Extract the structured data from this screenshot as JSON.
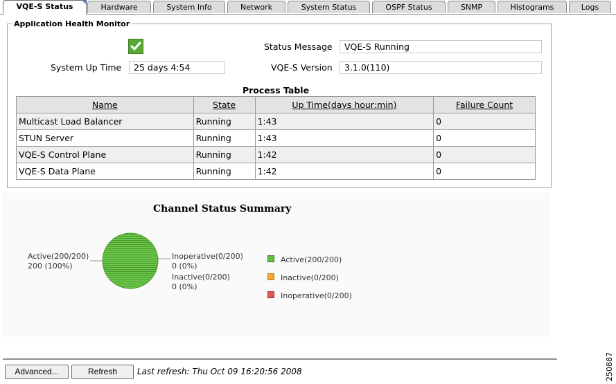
{
  "tabs": [
    {
      "label": "VQE-S Status",
      "active": true
    },
    {
      "label": "Hardware"
    },
    {
      "label": "System Info"
    },
    {
      "label": "Network"
    },
    {
      "label": "System Status"
    },
    {
      "label": "OSPF Status"
    },
    {
      "label": "SNMP"
    },
    {
      "label": "Histograms"
    },
    {
      "label": "Logs"
    }
  ],
  "health": {
    "legend": "Application Health Monitor",
    "status_icon": "checkmark-icon",
    "status_message_label": "Status Message",
    "status_message_value": "VQE-S Running",
    "uptime_label": "System Up Time",
    "uptime_value": "25 days  4:54",
    "version_label": "VQE-S Version",
    "version_value": "3.1.0(110)"
  },
  "process_table": {
    "title": "Process Table",
    "columns": [
      "Name",
      "State",
      "Up Time(days hour:min)",
      "Failure Count"
    ],
    "rows": [
      [
        "Multicast Load Balancer",
        "Running",
        "1:43",
        "0"
      ],
      [
        "STUN Server",
        "Running",
        "1:43",
        "0"
      ],
      [
        "VQE-S Control Plane",
        "Running",
        "1:42",
        "0"
      ],
      [
        "VQE-S Data Plane",
        "Running",
        "1:42",
        "0"
      ]
    ]
  },
  "chart_data": {
    "type": "pie",
    "title": "Channel Status Summary",
    "categories": [
      "Active(200/200)",
      "Inactive(0/200)",
      "Inoperative(0/200)"
    ],
    "values": [
      200,
      0,
      0
    ],
    "labels": {
      "active_name": "Active(200/200)",
      "active_value": "200 (100%)",
      "inoperative_name": "Inoperative(0/200)",
      "inoperative_value": "0 (0%)",
      "inactive_name": "Inactive(0/200)",
      "inactive_value": "0 (0%)"
    },
    "legend": [
      "Active(200/200)",
      "Inactive(0/200)",
      "Inoperative(0/200)"
    ],
    "colors": {
      "active": "#66bb44",
      "inactive": "#f0a830",
      "inoperative": "#e05555"
    },
    "legend_position": "right"
  },
  "footer": {
    "advanced_label": "Advanced...",
    "refresh_label": "Refresh",
    "last_refresh": "Last refresh: Thu Oct 09 16:20:56 2008"
  },
  "side_id": "250887"
}
